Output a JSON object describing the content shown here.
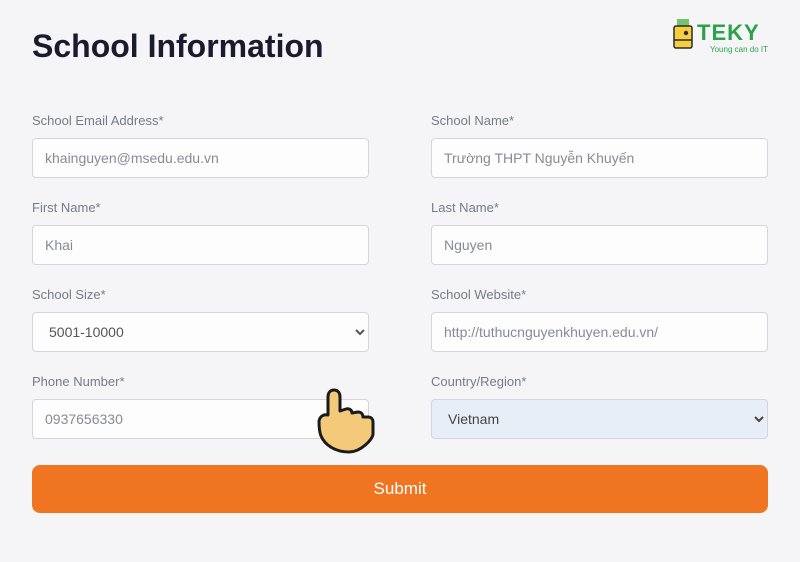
{
  "heading": "School Information",
  "logo": {
    "main": "TEKY",
    "sub": "Young can do IT"
  },
  "fields": {
    "school_email": {
      "label": "School Email Address*",
      "value": "khainguyen@msedu.edu.vn"
    },
    "school_name": {
      "label": "School Name*",
      "value": "Trường THPT Nguyễn Khuyến"
    },
    "first_name": {
      "label": "First Name*",
      "value": "Khai"
    },
    "last_name": {
      "label": "Last Name*",
      "value": "Nguyen"
    },
    "school_size": {
      "label": "School Size*",
      "value": "5001-10000"
    },
    "school_site": {
      "label": "School Website*",
      "value": "http://tuthucnguyenkhuyen.edu.vn/"
    },
    "phone": {
      "label": "Phone Number*",
      "value": "0937656330"
    },
    "country": {
      "label": "Country/Region*",
      "value": "Vietnam"
    }
  },
  "submit_label": "Submit"
}
